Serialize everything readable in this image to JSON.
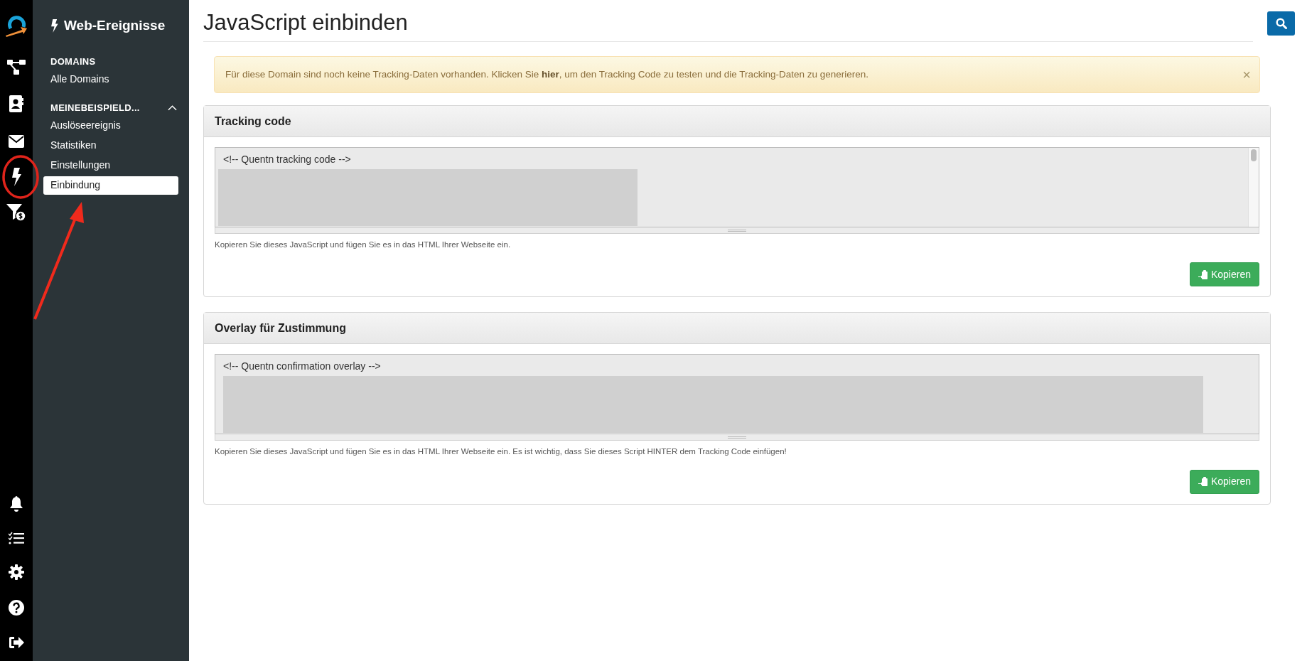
{
  "sidebar": {
    "title": "Web-Ereignisse",
    "sections": [
      {
        "heading": "DOMAINS",
        "items": [
          {
            "label": "Alle Domains",
            "selected": false
          }
        ]
      },
      {
        "heading": "MEINEBEISPIELD...",
        "expanded": true,
        "items": [
          {
            "label": "Auslöseereignis",
            "selected": false
          },
          {
            "label": "Statistiken",
            "selected": false
          },
          {
            "label": "Einstellungen",
            "selected": false
          },
          {
            "label": "Einbindung",
            "selected": true
          }
        ]
      }
    ]
  },
  "page": {
    "title": "JavaScript einbinden"
  },
  "alert": {
    "text": "Für diese Domain sind noch keine Tracking-Daten vorhanden. Klicken Sie **hier**, um den Tracking Code zu testen und die Tracking-Daten zu generieren.",
    "close": "×"
  },
  "cards": [
    {
      "title": "Tracking code",
      "code": "<!-- Quentn tracking code -->",
      "scrollbar": true,
      "help": "Kopieren Sie dieses JavaScript und fügen Sie es in das HTML Ihrer Webseite ein.",
      "button": "Kopieren"
    },
    {
      "title": "Overlay für Zustimmung",
      "code": "<!-- Quentn confirmation overlay -->",
      "scrollbar": false,
      "help": "Kopieren Sie dieses JavaScript und fügen Sie es in das HTML Ihrer Webseite ein. Es ist wichtig, dass Sie dieses Script HINTER dem Tracking Code einfügen!",
      "button": "Kopieren"
    }
  ]
}
